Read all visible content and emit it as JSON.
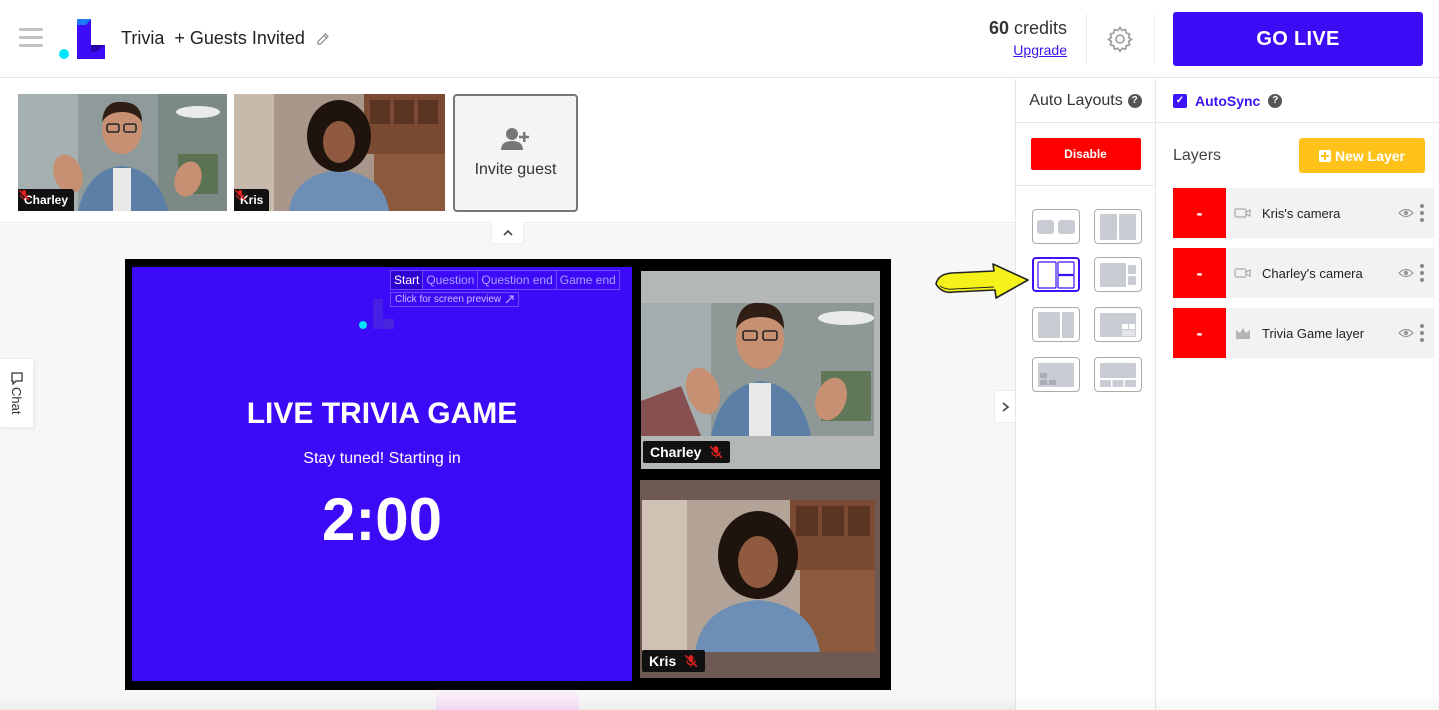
{
  "header": {
    "title": "Trivia",
    "guests_label": "+ Guests Invited",
    "credits_count": "60",
    "credits_unit": "credits",
    "upgrade_label": "Upgrade",
    "go_live_label": "GO LIVE"
  },
  "guests": [
    {
      "name": "Charley",
      "muted": true
    },
    {
      "name": "Kris",
      "muted": true
    }
  ],
  "invite_label": "Invite guest",
  "chat_label": "Chat",
  "game": {
    "tabs": [
      "Start",
      "Question",
      "Question end",
      "Game end"
    ],
    "active_tab": "Start",
    "preview_link": "Click for screen preview",
    "title": "LIVE TRIVIA GAME",
    "subtitle": "Stay tuned! Starting in",
    "timer": "2:00"
  },
  "stage_cameras": [
    {
      "name": "Charley",
      "muted": true
    },
    {
      "name": "Kris",
      "muted": true
    }
  ],
  "auto_layouts": {
    "title": "Auto Layouts",
    "disable_label": "Disable",
    "selected_index": 2
  },
  "layers_panel": {
    "autosync_label": "AutoSync",
    "autosync_checked": true,
    "title": "Layers",
    "new_layer_label": "New Layer",
    "remove_label": "-",
    "layers": [
      {
        "name": "Kris's camera",
        "icon": "camera-icon"
      },
      {
        "name": "Charley's camera",
        "icon": "camera-icon"
      },
      {
        "name": "Trivia Game layer",
        "icon": "crown-icon"
      }
    ]
  },
  "colors": {
    "brand": "#3d0bf5",
    "danger": "#ff0000",
    "accent_yellow": "#ffc21a",
    "logo_cyan": "#00e5ff"
  }
}
